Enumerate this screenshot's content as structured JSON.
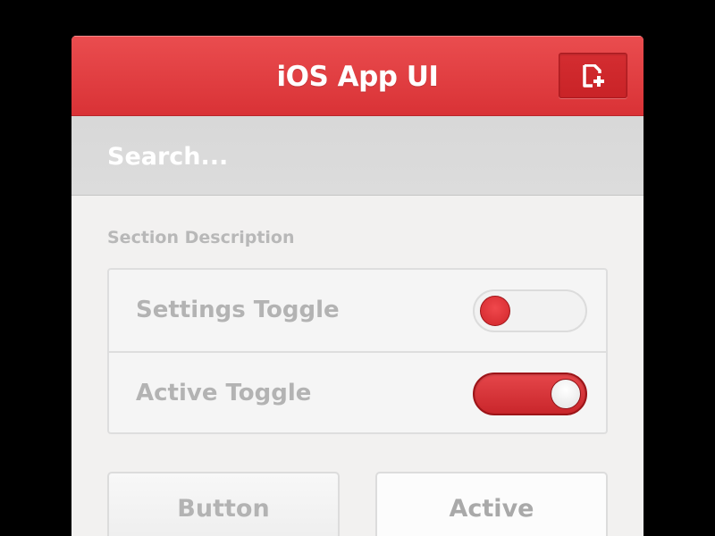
{
  "navbar": {
    "title": "iOS App UI",
    "add_icon": "add-document-icon"
  },
  "search": {
    "placeholder": "Search..."
  },
  "section": {
    "description": "Section Description"
  },
  "settings": {
    "rows": [
      {
        "label": "Settings Toggle",
        "state": "off"
      },
      {
        "label": "Active Toggle",
        "state": "on"
      }
    ]
  },
  "buttons": {
    "normal_label": "Button",
    "active_label": "Active"
  },
  "colors": {
    "accent": "#d93236",
    "background": "#f2f1f0",
    "search_bar": "#d8d8d8",
    "label_gray": "#b3b3b3"
  }
}
